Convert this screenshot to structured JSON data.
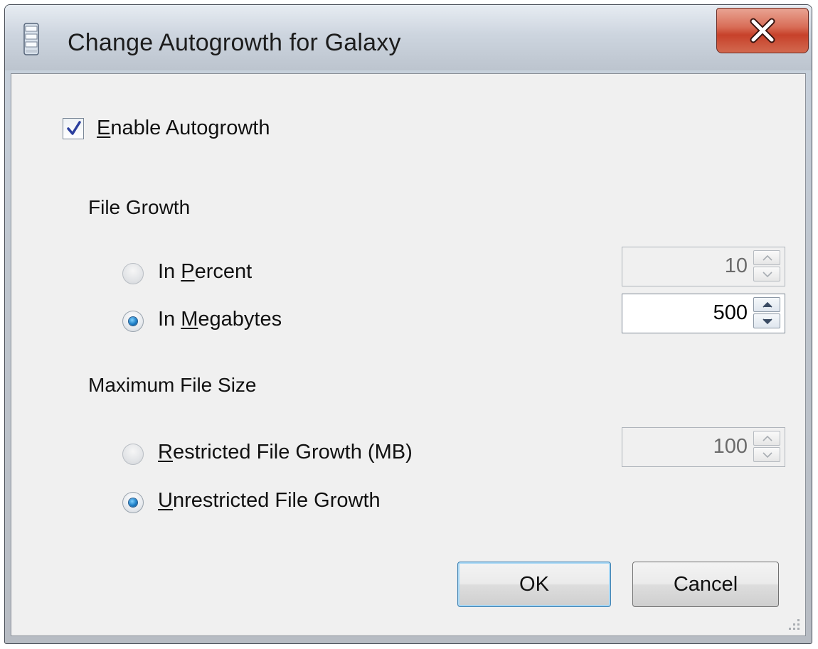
{
  "window": {
    "title": "Change Autogrowth for Galaxy",
    "icon": "database-icon",
    "close_icon": "close-icon"
  },
  "autogrowth": {
    "enable_label_mnemonic": "E",
    "enable_label_rest": "nable Autogrowth",
    "enabled": true
  },
  "file_growth": {
    "group_label": "File Growth",
    "percent": {
      "label_prefix": "In ",
      "label_mnemonic": "P",
      "label_rest": "ercent",
      "selected": false,
      "value": "10",
      "enabled": false
    },
    "megabytes": {
      "label_prefix": "In ",
      "label_mnemonic": "M",
      "label_rest": "egabytes",
      "selected": true,
      "value": "500",
      "enabled": true
    }
  },
  "max_file_size": {
    "group_label": "Maximum File Size",
    "restricted": {
      "label_mnemonic": "R",
      "label_rest": "estricted File Growth (MB)",
      "selected": false,
      "value": "100",
      "enabled": false
    },
    "unrestricted": {
      "label_mnemonic": "U",
      "label_rest": "nrestricted File Growth",
      "selected": true
    }
  },
  "buttons": {
    "ok_label": "OK",
    "cancel_label": "Cancel"
  },
  "colors": {
    "close_button": "#c7412a",
    "radio_selected": "#1e7fc7",
    "checkmark": "#2b3f9e"
  }
}
